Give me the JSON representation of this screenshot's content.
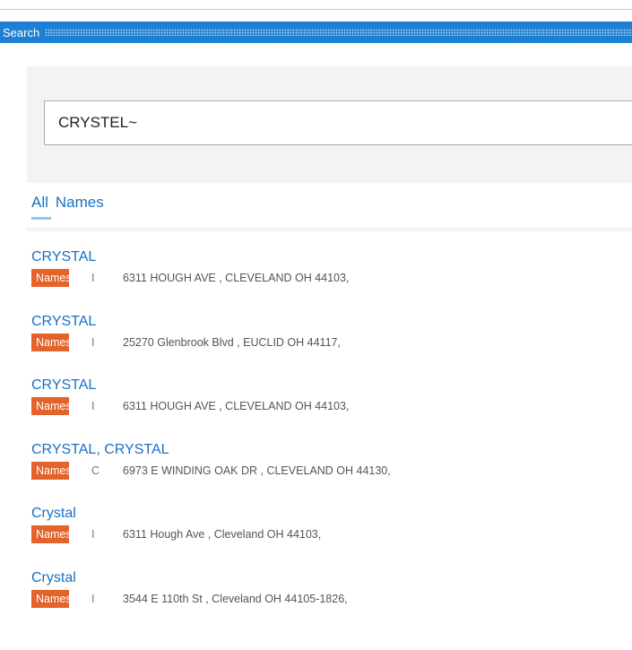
{
  "window": {
    "title": "Search"
  },
  "search": {
    "query": "CRYSTEL~"
  },
  "tabs": [
    {
      "label": "All",
      "active": true
    },
    {
      "label": "Names",
      "active": false
    }
  ],
  "results": [
    {
      "name": "CRYSTAL",
      "badge": "Names",
      "type": "I",
      "address": "6311  HOUGH AVE , CLEVELAND OH  44103,"
    },
    {
      "name": "CRYSTAL",
      "badge": "Names",
      "type": "I",
      "address": "25270  Glenbrook Blvd , EUCLID OH  44117,"
    },
    {
      "name": "CRYSTAL",
      "badge": "Names",
      "type": "I",
      "address": "6311  HOUGH AVE , CLEVELAND OH  44103,"
    },
    {
      "name": "CRYSTAL, CRYSTAL",
      "badge": "Names",
      "type": "C",
      "address": "6973 E WINDING OAK DR , CLEVELAND OH  44130,"
    },
    {
      "name": "Crystal",
      "badge": "Names",
      "type": "I",
      "address": "6311  Hough Ave , Cleveland OH  44103,"
    },
    {
      "name": "Crystal",
      "badge": "Names",
      "type": "I",
      "address": "3544  E 110th St , Cleveland OH  44105-1826,"
    }
  ],
  "colors": {
    "title_bar": "#1e80d4",
    "link": "#1a6fc4",
    "badge": "#e4632a",
    "tab_underline": "#8ec5ef"
  }
}
